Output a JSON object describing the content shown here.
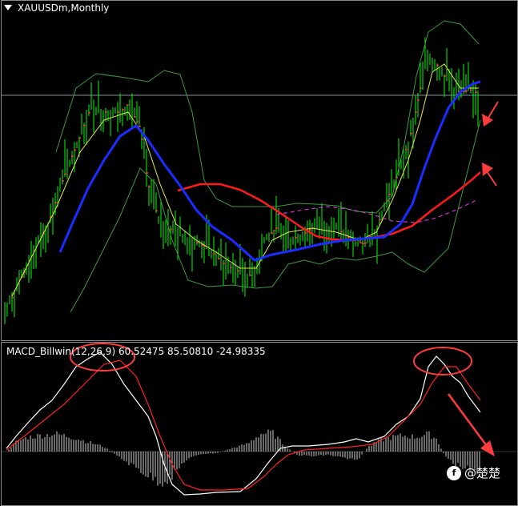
{
  "window": {
    "symbol_title": "XAUUSDm,Monthly"
  },
  "indicator": {
    "macd_label": "MACD_Billwin(12,26,9) 60.52475 85.50810 -24.98335"
  },
  "watermark": {
    "icon": "f",
    "text": "@楚楚"
  },
  "colors": {
    "background": "#000000",
    "candle": "#00ff00",
    "bollinger": "#3c9b3c",
    "ma_blue": "#1a2cff",
    "ma_red": "#ff1a1a",
    "ma_magenta": "#cc33cc",
    "ma_yellow": "#e8e84a",
    "macd_line": "#ffffff",
    "signal_line": "#ff2020",
    "annotation": "#ff3c3c"
  },
  "chart_data": {
    "type": "line",
    "title": "XAUUSDm,Monthly",
    "grid": false,
    "series": [
      {
        "name": "MACD_Billwin(12,26,9)",
        "values": [
          60.52475,
          85.5081,
          -24.98335
        ]
      }
    ]
  }
}
